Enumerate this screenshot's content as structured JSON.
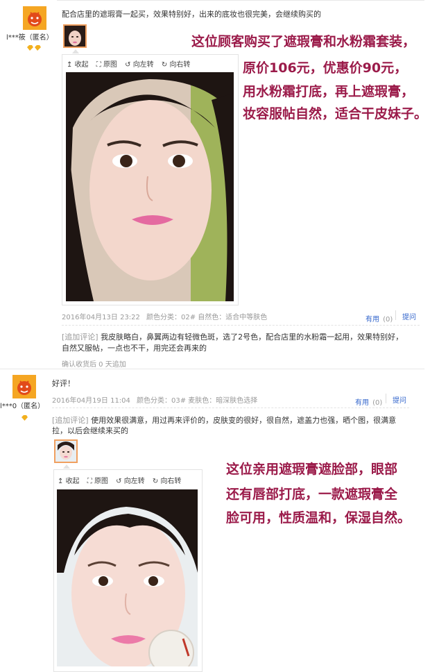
{
  "review1": {
    "username": "l***筱（匿名）",
    "content": "配合店里的遮瑕膏一起买，效果特别好，出来的底妆也很完美，会继续购买的",
    "toolbar": {
      "collapse": "收起",
      "original": "原图",
      "rotate_left": "向左转",
      "rotate_right": "向右转"
    },
    "date": "2016年04月13日 23:22",
    "spec": "颜色分类：02# 自然色：适合中等肤色",
    "useful": "有用",
    "useful_count": "(0)",
    "reply": "提问",
    "followup_tag": "[追加评论]",
    "followup_line1": "我皮肤略白，鼻翼两边有轻微色斑，选了2号色，配合店里的水粉霜一起用，效果特别好，",
    "followup_line2": "自然又服帖，一点也不干，用完还会再来的",
    "followup_when": "确认收货后 0 天追加"
  },
  "review2": {
    "username": "l***0（匿名）",
    "content": "好评！",
    "date": "2016年04月19日 11:04",
    "spec": "颜色分类：03# 麦肤色：暗深肤色选择",
    "useful": "有用",
    "useful_count": "(0)",
    "reply": "提问",
    "followup_tag": "[追加评论]",
    "followup_line1": "使用效果很满意，用过再来评价的，皮肤变的很好，很自然，遮盖力也强，晒个图，很满意",
    "followup_line2": "拉，以后会继续来买的",
    "toolbar": {
      "collapse": "收起",
      "original": "原图",
      "rotate_left": "向左转",
      "rotate_right": "向右转"
    }
  },
  "promo1": {
    "line1": "这位顾客购买了遮瑕膏和水粉霜套装，",
    "line2": "原价106元，优惠价90元，",
    "line3": "用水粉霜打底，再上遮瑕膏，",
    "line4": "妆容服帖自然，适合干皮妹子。"
  },
  "promo2": {
    "line1": "这位亲用遮瑕膏遮脸部，眼部",
    "line2": "还有唇部打底，一款遮瑕膏全",
    "line3": "脸可用，性质温和，保湿自然。"
  },
  "colors": {
    "promo": "#9b1b4a",
    "link": "#3366cc",
    "avatar": "#f5a623",
    "thumb_border": "#f0a060"
  }
}
